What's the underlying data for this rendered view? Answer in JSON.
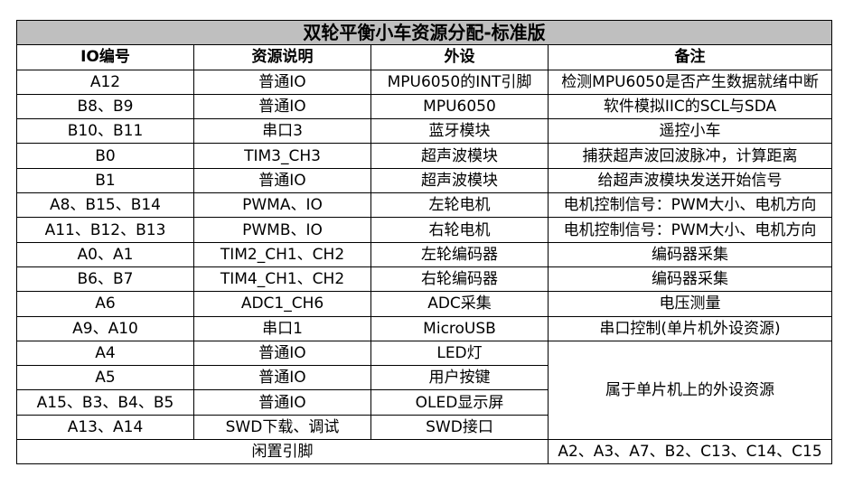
{
  "title": "双轮平衡小车资源分配-标准版",
  "headers": [
    "IO编号",
    "资源说明",
    "外设",
    "备注"
  ],
  "rows": [
    [
      "A12",
      "普通IO",
      "MPU6050的INT引脚",
      "检测MPU6050是否产生数据就绪中断"
    ],
    [
      "B8、B9",
      "普通IO",
      "MPU6050",
      "软件模拟IIC的SCL与SDA"
    ],
    [
      "B10、B11",
      "串口3",
      "蓝牙模块",
      "遥控小车"
    ],
    [
      "B0",
      "TIM3_CH3",
      "超声波模块",
      "捕获超声波回波脉冲，计算距离"
    ],
    [
      "B1",
      "普通IO",
      "超声波模块",
      "给超声波模块发送开始信号"
    ],
    [
      "A8、B15、B14",
      "PWMA、IO",
      "左轮电机",
      "电机控制信号：PWM大小、电机方向"
    ],
    [
      "A11、B12、B13",
      "PWMB、IO",
      "右轮电机",
      "电机控制信号：PWM大小、电机方向"
    ],
    [
      "A0、A1",
      "TIM2_CH1、CH2",
      "左轮编码器",
      "编码器采集"
    ],
    [
      "B6、B7",
      "TIM4_CH1、CH2",
      "右轮编码器",
      "编码器采集"
    ],
    [
      "A6",
      "ADC1_CH6",
      "ADC采集",
      "电压测量"
    ],
    [
      "A9、A10",
      "串口1",
      "MicroUSB",
      "串口控制(单片机外设资源)"
    ],
    [
      "A4",
      "普通IO",
      "LED灯",
      "属于单片机上的外设资源"
    ],
    [
      "A5",
      "普通IO",
      "用户按键",
      ""
    ],
    [
      "A15、B3、B4、B5",
      "普通IO",
      "OLED显示屏",
      ""
    ],
    [
      "A13、A14",
      "SWD下载、调试",
      "SWD接口",
      ""
    ]
  ],
  "footer": {
    "label": "闲置引脚",
    "value": "A2、A3、A7、B2、C13、C14、C15"
  },
  "colors": {
    "title_bg": "#bfbfbf",
    "border": "#000000"
  }
}
